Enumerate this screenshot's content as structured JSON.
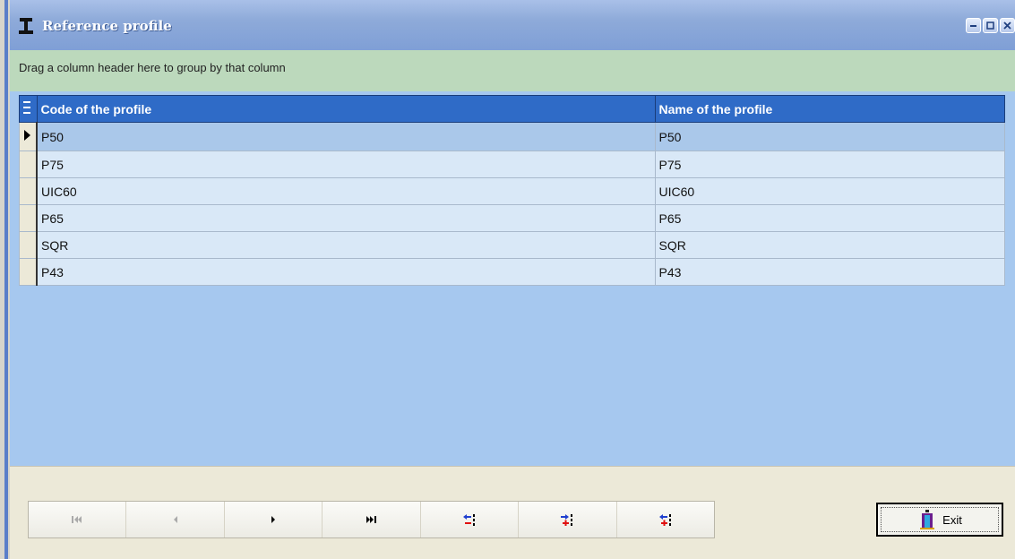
{
  "window": {
    "title": "Reference profile"
  },
  "group_panel": {
    "hint": "Drag a column header here to group by that column"
  },
  "grid": {
    "columns": [
      "Code of the profile",
      "Name of the profile"
    ],
    "rows": [
      {
        "code": "P50",
        "name": "P50"
      },
      {
        "code": "P75",
        "name": "P75"
      },
      {
        "code": "UIC60",
        "name": "UIC60"
      },
      {
        "code": "P65",
        "name": "P65"
      },
      {
        "code": "SQR",
        "name": "SQR"
      },
      {
        "code": "P43",
        "name": "P43"
      }
    ],
    "selected_row": 0
  },
  "navigator": {
    "buttons": [
      "first-record",
      "previous-record",
      "next-record",
      "last-record",
      "delete-record",
      "insert-record",
      "append-record"
    ]
  },
  "exit_button": {
    "label": "Exit"
  },
  "colors": {
    "header": "#2f6bc7",
    "row": "#d9e8f7",
    "selected_row": "#aac8ea",
    "grid_background": "#a6c8ef",
    "group_panel": "#bcd9bc"
  }
}
